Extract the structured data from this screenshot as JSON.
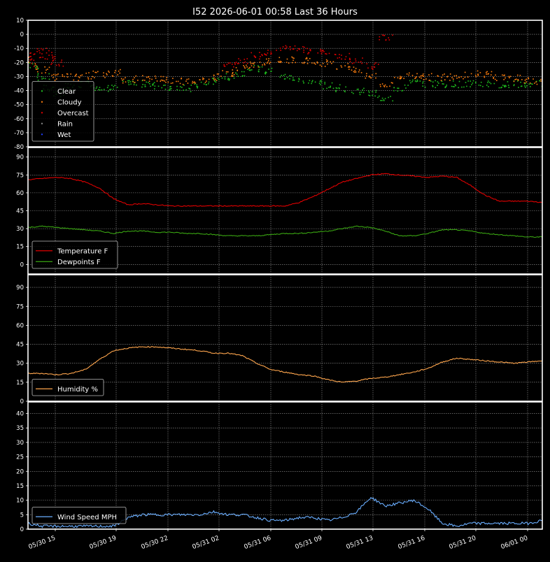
{
  "title": "I52 2026-06-01 00:58 Last 36 Hours",
  "x_ticks": [
    "05/30 15",
    "05/30 19",
    "05/30 22",
    "05/31 02",
    "05/31 06",
    "05/31 09",
    "05/31 13",
    "05/31 16",
    "05/31 20",
    "06/01 00"
  ],
  "colors": {
    "background": "#000000",
    "frame": "#ffffff",
    "grid": "#9a9a9a",
    "text": "#ffffff",
    "clear": "#1fbf1f",
    "cloudy": "#ff7f0e",
    "overcast": "#e00000",
    "rain": "#8a8a8a",
    "wet": "#1f3fff",
    "temperature": "#e00000",
    "dewpoint": "#3aa612",
    "humidity": "#ffa64d",
    "wind": "#6aaeff"
  },
  "chart_data": [
    {
      "type": "scatter",
      "id": "sky",
      "ylim": [
        -80,
        10
      ],
      "yticks": [
        10,
        0,
        -10,
        -20,
        -30,
        -40,
        -50,
        -60,
        -70,
        -80
      ],
      "legend": {
        "position": "lower-left",
        "entries": [
          "Clear",
          "Cloudy",
          "Overcast",
          "Rain",
          "Wet"
        ]
      },
      "series": [
        {
          "name": "Clear",
          "color_key": "clear",
          "x": [
            0.5,
            1,
            1.5,
            2,
            3,
            4,
            5,
            6,
            7,
            8,
            9,
            10,
            11,
            12,
            13,
            14,
            15,
            16,
            17,
            18,
            19,
            20,
            21,
            22,
            23,
            24,
            25,
            26,
            27,
            28,
            29,
            30,
            31,
            32,
            33,
            34,
            35,
            36
          ],
          "y": [
            -22,
            -30,
            -38,
            -42,
            -37,
            -35,
            -37,
            -38,
            -35,
            -35,
            -36,
            -37,
            -38,
            -36,
            -33,
            -30,
            -27,
            -24,
            -26,
            -30,
            -32,
            -34,
            -36,
            -38,
            -40,
            -42,
            -45,
            -38,
            -34,
            -35,
            -35,
            -35,
            -35,
            -35,
            -36,
            -35,
            -35,
            -35
          ]
        },
        {
          "name": "Cloudy",
          "color_key": "cloudy",
          "x": [
            0,
            1,
            2,
            3,
            4,
            5,
            6,
            7,
            8,
            9,
            10,
            11,
            12,
            13,
            14,
            15,
            16,
            17,
            18,
            19,
            20,
            21,
            22,
            23,
            24,
            25,
            26,
            27,
            28,
            29,
            30,
            31,
            32,
            33,
            34,
            35,
            36
          ],
          "y": [
            -18,
            -25,
            -30,
            -30,
            -29,
            -28,
            -27,
            -32,
            -31,
            -31,
            -32,
            -33,
            -32,
            -30,
            -27,
            -24,
            -21,
            -19,
            -18,
            -18,
            -19,
            -20,
            -22,
            -25,
            -30,
            -35,
            -30,
            -29,
            -30,
            -30,
            -29,
            -28,
            -28,
            -30,
            -31,
            -32,
            -33
          ]
        },
        {
          "name": "Overcast",
          "color_key": "overcast",
          "x": [
            0,
            0.5,
            1,
            1.5,
            2,
            14,
            15,
            16,
            17,
            18,
            19,
            20,
            21,
            22,
            23,
            24,
            25
          ],
          "y": [
            -20,
            -15,
            -12,
            -15,
            -20,
            -22,
            -18,
            -15,
            -12,
            -10,
            -10,
            -11,
            -13,
            -15,
            -18,
            -22,
            -2
          ]
        },
        {
          "name": "Rain",
          "color_key": "rain",
          "x": [],
          "y": []
        },
        {
          "name": "Wet",
          "color_key": "wet",
          "x": [],
          "y": []
        }
      ]
    },
    {
      "type": "line",
      "id": "temp",
      "ylim": [
        -8,
        98
      ],
      "yticks": [
        90,
        75,
        60,
        45,
        30,
        15,
        0
      ],
      "legend": {
        "position": "lower-left",
        "entries": [
          "Temperature F",
          "Dewpoints F"
        ]
      },
      "series": [
        {
          "name": "Temperature F",
          "color_key": "temperature",
          "x": [
            0,
            1,
            2,
            3,
            4,
            5,
            6,
            7,
            8,
            9,
            10,
            11,
            12,
            13,
            14,
            15,
            16,
            17,
            18,
            19,
            20,
            21,
            22,
            23,
            24,
            25,
            26,
            27,
            28,
            29,
            30,
            31,
            32,
            33,
            34,
            35,
            36
          ],
          "y": [
            71,
            72,
            73,
            72,
            69,
            64,
            55,
            50,
            51,
            50,
            49,
            49,
            49,
            49,
            49,
            49,
            49,
            49,
            49,
            52,
            57,
            63,
            69,
            72,
            75,
            76,
            75,
            74,
            73,
            74,
            73,
            66,
            58,
            53,
            53,
            53,
            52
          ]
        },
        {
          "name": "Dewpoints F",
          "color_key": "dewpoint",
          "x": [
            0,
            1,
            2,
            3,
            4,
            5,
            6,
            7,
            8,
            9,
            10,
            11,
            12,
            13,
            14,
            15,
            16,
            17,
            18,
            19,
            20,
            21,
            22,
            23,
            24,
            25,
            26,
            27,
            28,
            29,
            30,
            31,
            32,
            33,
            34,
            35,
            36
          ],
          "y": [
            31,
            32,
            31,
            30,
            29,
            28,
            26,
            28,
            28,
            27,
            27,
            26,
            26,
            25,
            24,
            24,
            24,
            25,
            26,
            26,
            27,
            28,
            30,
            32,
            31,
            28,
            24,
            24,
            26,
            29,
            29,
            28,
            26,
            25,
            24,
            23,
            23
          ]
        }
      ]
    },
    {
      "type": "line",
      "id": "humidity",
      "ylim": [
        0,
        100
      ],
      "yticks": [
        90,
        75,
        60,
        45,
        30,
        15,
        0
      ],
      "legend": {
        "position": "lower-left",
        "entries": [
          "Humidity %"
        ]
      },
      "series": [
        {
          "name": "Humidity %",
          "color_key": "humidity",
          "x": [
            0,
            1,
            2,
            3,
            4,
            5,
            6,
            7,
            8,
            9,
            10,
            11,
            12,
            13,
            14,
            15,
            16,
            17,
            18,
            19,
            20,
            21,
            22,
            23,
            24,
            25,
            26,
            27,
            28,
            29,
            30,
            31,
            32,
            33,
            34,
            35,
            36
          ],
          "y": [
            22,
            22,
            21,
            22,
            25,
            33,
            40,
            42,
            43,
            43,
            42,
            41,
            40,
            38,
            38,
            36,
            30,
            25,
            23,
            21,
            20,
            17,
            15,
            16,
            18,
            19,
            21,
            23,
            26,
            31,
            34,
            33,
            32,
            31,
            30,
            31,
            32
          ]
        }
      ]
    },
    {
      "type": "line",
      "id": "wind",
      "ylim": [
        0,
        44
      ],
      "yticks": [
        40,
        35,
        30,
        25,
        20,
        15,
        10,
        5,
        0
      ],
      "legend": {
        "position": "lower-left",
        "entries": [
          "Wind Speed MPH"
        ]
      },
      "series": [
        {
          "name": "Wind Speed MPH",
          "color_key": "wind",
          "x": [
            0,
            1,
            2,
            3,
            4,
            5,
            6,
            7,
            8,
            9,
            10,
            11,
            12,
            13,
            14,
            15,
            16,
            17,
            18,
            19,
            20,
            21,
            22,
            23,
            24,
            25,
            26,
            27,
            28,
            29,
            30,
            31,
            32,
            33,
            34,
            35,
            36
          ],
          "y": [
            2,
            1,
            1,
            1,
            1,
            1,
            1,
            4,
            5,
            5,
            5,
            5,
            5,
            6,
            5,
            5,
            4,
            3,
            3,
            4,
            4,
            3,
            4,
            6,
            11,
            8,
            9,
            10,
            7,
            2,
            1,
            2,
            2,
            2,
            2,
            2,
            3
          ]
        }
      ]
    }
  ]
}
